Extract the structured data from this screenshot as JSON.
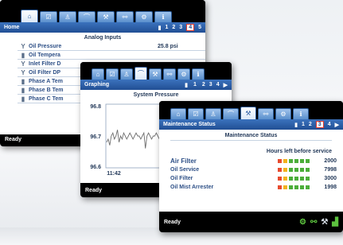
{
  "home": {
    "title": "Home",
    "pager": [
      "1",
      "2",
      "3",
      "4",
      "5"
    ],
    "active_page": "4",
    "section_title": "Analog Inputs",
    "rows": [
      {
        "label": "Oil Pressure",
        "value": "25.8 psi",
        "icon": "gauge-icon"
      },
      {
        "label": "Oil Tempera",
        "value": "",
        "icon": "thermometer-icon"
      },
      {
        "label": "Inlet Filter D",
        "value": "",
        "icon": "filter-icon"
      },
      {
        "label": "Oil Filter DP",
        "value": "",
        "icon": "filter-icon"
      },
      {
        "label": "Phase A Tem",
        "value": "",
        "icon": "thermometer-icon"
      },
      {
        "label": "Phase B Tem",
        "value": "",
        "icon": "thermometer-icon"
      },
      {
        "label": "Phase C Tem",
        "value": "",
        "icon": "thermometer-icon"
      }
    ],
    "status": "Ready"
  },
  "graphing": {
    "title": "Graphing",
    "pager": [
      "1",
      "2",
      "3",
      "4"
    ],
    "chart_title": "System Pressure",
    "status": "Ready",
    "chart_data": {
      "type": "line",
      "title": "System Pressure",
      "y_ticks": [
        "96.8",
        "96.7",
        "96.6"
      ],
      "ylim": [
        96.6,
        96.8
      ],
      "x_ticks": [
        "11:42"
      ],
      "series": [
        {
          "values": [
            96.68,
            96.69,
            96.67,
            96.7,
            96.71,
            96.69,
            96.7,
            96.72,
            96.68,
            96.7,
            96.69,
            96.71,
            96.7,
            96.69,
            96.7,
            96.71,
            96.7,
            96.69,
            96.7,
            96.71,
            96.7,
            96.7,
            96.69,
            96.7,
            96.71,
            96.66,
            96.7,
            96.71,
            96.7,
            96.69,
            96.7,
            96.7,
            96.71,
            96.7,
            96.69,
            96.7,
            96.7,
            96.71,
            96.7,
            96.7
          ]
        }
      ]
    }
  },
  "maintenance": {
    "title": "Maintenance Status",
    "pager": [
      "1",
      "2",
      "3",
      "4"
    ],
    "active_page": "3",
    "section_title": "Maintenance Status",
    "column_header": "Hours left before service",
    "rows": [
      {
        "label": "Air Filter",
        "hours": "2000",
        "blocks": [
          "#e84a2e",
          "#f2b21c",
          "#4cae3a",
          "#4cae3a",
          "#4cae3a",
          "#4cae3a"
        ]
      },
      {
        "label": "Oil Service",
        "hours": "7998",
        "blocks": [
          "#e84a2e",
          "#f2b21c",
          "#4cae3a",
          "#4cae3a",
          "#4cae3a",
          "#4cae3a"
        ]
      },
      {
        "label": "Oil Filter",
        "hours": "3000",
        "blocks": [
          "#e84a2e",
          "#f2b21c",
          "#4cae3a",
          "#4cae3a",
          "#4cae3a",
          "#4cae3a"
        ]
      },
      {
        "label": "Oil Mist Arrester",
        "hours": "1998",
        "blocks": [
          "#e84a2e",
          "#f2b21c",
          "#4cae3a",
          "#4cae3a",
          "#4cae3a",
          "#4cae3a"
        ]
      }
    ],
    "status": "Ready",
    "status_icons": [
      "gear-icon",
      "network-icon",
      "wrench-icon",
      "compressor-icon"
    ]
  },
  "tabs": [
    "home-icon",
    "checklist-icon",
    "person-icon",
    "graph-icon",
    "wrench-icon",
    "network-icon",
    "settings-icon",
    "info-icon"
  ],
  "colors": {
    "accent": "#2d5ea5",
    "active_page_border": "#e03a2c"
  }
}
